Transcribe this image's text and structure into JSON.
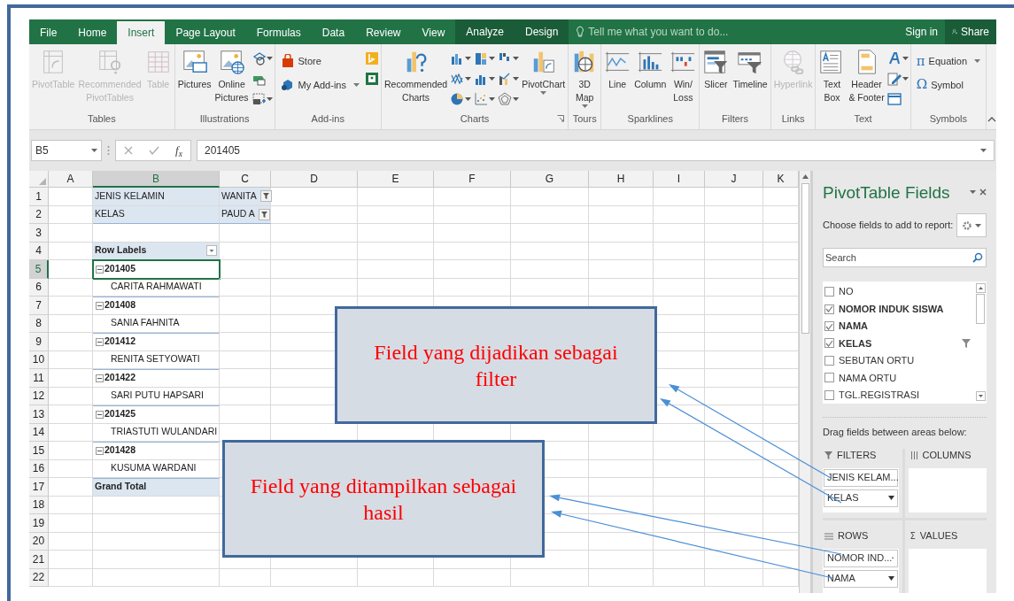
{
  "ribbon_tabs": [
    {
      "label": "File",
      "selected": false,
      "contextual": false
    },
    {
      "label": "Home",
      "selected": false,
      "contextual": false
    },
    {
      "label": "Insert",
      "selected": true,
      "contextual": false
    },
    {
      "label": "Page Layout",
      "selected": false,
      "contextual": false
    },
    {
      "label": "Formulas",
      "selected": false,
      "contextual": false
    },
    {
      "label": "Data",
      "selected": false,
      "contextual": false
    },
    {
      "label": "Review",
      "selected": false,
      "contextual": false
    },
    {
      "label": "View",
      "selected": false,
      "contextual": false
    },
    {
      "label": "Analyze",
      "selected": false,
      "contextual": true
    },
    {
      "label": "Design",
      "selected": false,
      "contextual": true
    }
  ],
  "tell_me": {
    "placeholder": "Tell me what you want to do..."
  },
  "sign_in": "Sign in",
  "share": "Share",
  "ribbon_groups": [
    {
      "label": "Tables",
      "buttons": [
        {
          "label": "PivotTable",
          "disabled": true,
          "dropdown": false
        },
        {
          "label": "Recommended\nPivotTables",
          "disabled": true,
          "dropdown": false
        },
        {
          "label": "Table",
          "disabled": true,
          "dropdown": false
        }
      ]
    },
    {
      "label": "Illustrations",
      "buttons": [
        {
          "label": "Pictures",
          "disabled": false,
          "dropdown": false
        },
        {
          "label": "Online\nPictures",
          "disabled": false,
          "dropdown": false
        }
      ]
    },
    {
      "label": "Add-ins",
      "small_buttons": [
        {
          "label": "Store",
          "dropdown": false
        },
        {
          "label": "My Add-ins",
          "dropdown": true
        }
      ]
    },
    {
      "label": "Charts",
      "buttons": [
        {
          "label": "Recommended\nCharts",
          "disabled": false,
          "dropdown": false
        },
        {
          "label": "PivotChart",
          "disabled": false,
          "dropdown": true
        }
      ]
    },
    {
      "label": "Tours",
      "buttons": [
        {
          "label": "3D\nMap",
          "disabled": false,
          "dropdown": true
        }
      ]
    },
    {
      "label": "Sparklines",
      "buttons": [
        {
          "label": "Line",
          "disabled": false,
          "dropdown": false
        },
        {
          "label": "Column",
          "disabled": false,
          "dropdown": false
        },
        {
          "label": "Win/\nLoss",
          "disabled": false,
          "dropdown": false
        }
      ]
    },
    {
      "label": "Filters",
      "buttons": [
        {
          "label": "Slicer",
          "disabled": false,
          "dropdown": false
        },
        {
          "label": "Timeline",
          "disabled": false,
          "dropdown": false
        }
      ]
    },
    {
      "label": "Links",
      "buttons": [
        {
          "label": "Hyperlink",
          "disabled": true,
          "dropdown": false
        }
      ]
    },
    {
      "label": "Text",
      "buttons": [
        {
          "label": "Text\nBox",
          "disabled": false,
          "dropdown": false
        },
        {
          "label": "Header\n& Footer",
          "disabled": false,
          "dropdown": false
        }
      ]
    },
    {
      "label": "Symbols",
      "small_buttons": [
        {
          "glyph": "π",
          "label": "Equation",
          "dropdown": true
        },
        {
          "glyph": "Ω",
          "label": "Symbol",
          "dropdown": false
        }
      ]
    }
  ],
  "formula_bar": {
    "name_box": "B5",
    "function_label": "f$_{x}$",
    "value": "201405"
  },
  "sheet": {
    "columns": [
      {
        "label": "A",
        "selected": false
      },
      {
        "label": "B",
        "selected": true
      },
      {
        "label": "C",
        "selected": false
      },
      {
        "label": "D",
        "selected": false
      },
      {
        "label": "E",
        "selected": false
      },
      {
        "label": "F",
        "selected": false
      },
      {
        "label": "G",
        "selected": false
      },
      {
        "label": "H",
        "selected": false
      },
      {
        "label": "I",
        "selected": false
      },
      {
        "label": "J",
        "selected": false
      },
      {
        "label": "K",
        "selected": false
      }
    ],
    "rows": [
      {
        "number": "1",
        "selected": false,
        "kind": "filter",
        "label": "JENIS KELAMIN",
        "value": "WANITA"
      },
      {
        "number": "2",
        "selected": false,
        "kind": "filter",
        "label": "KELAS",
        "value": "PAUD A"
      },
      {
        "number": "3",
        "selected": false,
        "kind": "blank"
      },
      {
        "number": "4",
        "selected": false,
        "kind": "header",
        "label": "Row Labels"
      },
      {
        "number": "5",
        "selected": true,
        "kind": "group",
        "label": "201405"
      },
      {
        "number": "6",
        "selected": false,
        "kind": "item",
        "label": "CARITA RAHMAWATI"
      },
      {
        "number": "7",
        "selected": false,
        "kind": "group",
        "label": "201408"
      },
      {
        "number": "8",
        "selected": false,
        "kind": "item",
        "label": "SANIA FAHNITA"
      },
      {
        "number": "9",
        "selected": false,
        "kind": "group",
        "label": "201412"
      },
      {
        "number": "10",
        "selected": false,
        "kind": "item",
        "label": "RENITA SETYOWATI"
      },
      {
        "number": "11",
        "selected": false,
        "kind": "group",
        "label": "201422"
      },
      {
        "number": "12",
        "selected": false,
        "kind": "item",
        "label": "SARI PUTU HAPSARI"
      },
      {
        "number": "13",
        "selected": false,
        "kind": "group",
        "label": "201425"
      },
      {
        "number": "14",
        "selected": false,
        "kind": "item",
        "label": "TRIASTUTI WULANDARI"
      },
      {
        "number": "15",
        "selected": false,
        "kind": "group",
        "label": "201428"
      },
      {
        "number": "16",
        "selected": false,
        "kind": "item",
        "label": "KUSUMA WARDANI"
      },
      {
        "number": "17",
        "selected": false,
        "kind": "total",
        "label": "Grand Total"
      },
      {
        "number": "18",
        "selected": false,
        "kind": "empty"
      },
      {
        "number": "19",
        "selected": false,
        "kind": "empty"
      },
      {
        "number": "20",
        "selected": false,
        "kind": "empty"
      },
      {
        "number": "21",
        "selected": false,
        "kind": "empty"
      },
      {
        "number": "22",
        "selected": false,
        "kind": "empty"
      }
    ]
  },
  "pivot_pane": {
    "title": "PivotTable Fields",
    "instruction": "Choose fields to add to report:",
    "search": {
      "placeholder": "Search"
    },
    "fields": [
      {
        "label": "NO",
        "checked": false,
        "filtered": false
      },
      {
        "label": "NOMOR INDUK SISWA",
        "checked": true,
        "filtered": false
      },
      {
        "label": "NAMA",
        "checked": true,
        "filtered": false
      },
      {
        "label": "KELAS",
        "checked": true,
        "filtered": true
      },
      {
        "label": "SEBUTAN ORTU",
        "checked": false,
        "filtered": false
      },
      {
        "label": "NAMA ORTU",
        "checked": false,
        "filtered": false
      },
      {
        "label": "TGL.REGISTRASI",
        "checked": false,
        "filtered": false
      }
    ],
    "areas_instruction": "Drag fields between areas below:",
    "areas": [
      {
        "kind": "filters",
        "label": "FILTERS",
        "items": [
          "JENIS KELAM...",
          "KELAS"
        ]
      },
      {
        "kind": "columns",
        "label": "COLUMNS"
      },
      {
        "kind": "rows",
        "label": "ROWS",
        "items": [
          "NOMOR IND...",
          "NAMA"
        ]
      },
      {
        "kind": "values",
        "glyph": "Σ",
        "label": "VALUES"
      }
    ]
  },
  "callouts": [
    {
      "text": "Field yang dijadikan sebagai filter"
    },
    {
      "text": "Field yang ditampilkan sebagai hasil"
    }
  ]
}
